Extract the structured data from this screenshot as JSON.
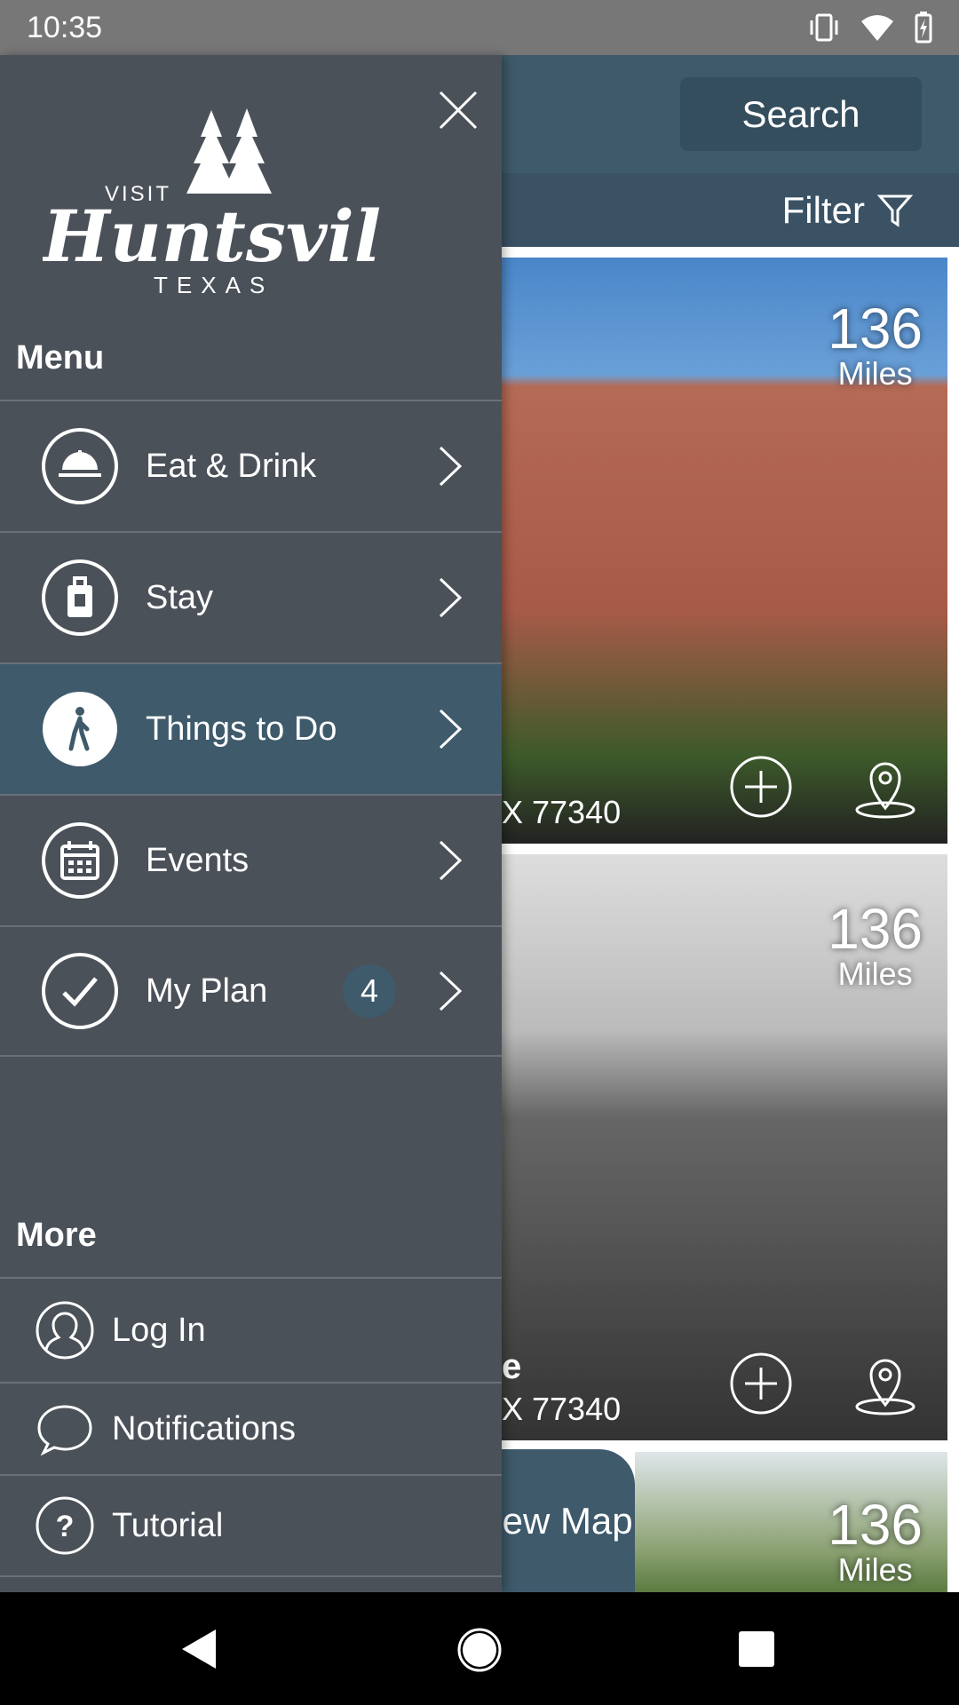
{
  "status_bar": {
    "time": "10:35",
    "icons": [
      "vibrate-icon",
      "wifi-icon",
      "battery-charging-icon"
    ]
  },
  "header": {
    "search_label": "Search",
    "filter_label": "Filter"
  },
  "cards": [
    {
      "distance": "136",
      "unit": "Miles",
      "address_fragment": "X 77340",
      "title_fragment": ""
    },
    {
      "distance": "136",
      "unit": "Miles",
      "address_fragment": "X 77340",
      "title_fragment": "e"
    },
    {
      "distance": "136",
      "unit": "Miles"
    }
  ],
  "map_button": {
    "label": "View Map"
  },
  "drawer": {
    "logo": {
      "line1": "VISIT",
      "line2": "Huntsville",
      "line3": "TEXAS"
    },
    "menu_heading": "Menu",
    "menu_items": [
      {
        "label": "Eat & Drink",
        "icon": "food-cloche-icon"
      },
      {
        "label": "Stay",
        "icon": "luggage-icon"
      },
      {
        "label": "Things to Do",
        "icon": "walking-person-icon",
        "active": true
      },
      {
        "label": "Events",
        "icon": "calendar-icon"
      },
      {
        "label": "My Plan",
        "icon": "checkmark-icon",
        "badge": "4"
      }
    ],
    "more_heading": "More",
    "more_items": [
      {
        "label": "Log In",
        "icon": "user-icon"
      },
      {
        "label": "Notifications",
        "icon": "chat-bubble-icon"
      },
      {
        "label": "Tutorial",
        "icon": "help-icon"
      }
    ]
  },
  "colors": {
    "drawer_bg": "#4b5159",
    "accent": "#3e5a6b",
    "status_bar": "#777777"
  }
}
